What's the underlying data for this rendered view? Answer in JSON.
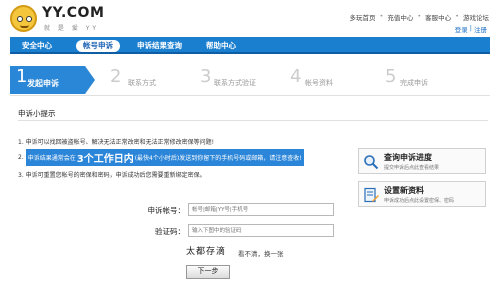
{
  "brand": {
    "name": "YY.COM",
    "slogan": "就 是 爱 YY"
  },
  "topnav": [
    "多玩首页",
    "充值中心",
    "客服中心",
    "游戏论坛"
  ],
  "userlinks": {
    "login": "登录",
    "sep": "|",
    "register": "注册"
  },
  "navbar": {
    "items": [
      "安全中心",
      "帐号申诉",
      "申诉结果查询",
      "帮助中心"
    ],
    "active_index": 1
  },
  "steps": [
    {
      "num": "1",
      "label": "发起申诉"
    },
    {
      "num": "2",
      "label": "联系方式"
    },
    {
      "num": "3",
      "label": "联系方式验证"
    },
    {
      "num": "4",
      "label": "帐号资料"
    },
    {
      "num": "5",
      "label": "完成申诉"
    }
  ],
  "tips": {
    "title": "申诉小提示",
    "line1": "1. 申诉可以找回被盗帐号、解决无法正常改密和无法正常修改密保等问题!",
    "line2_prefix": "2.",
    "line2_a": "申诉结果通常会在",
    "line2_big": "3个工作日内",
    "line2_b": "(最快4个小时后)发送到你留下的手机号码或邮箱，请注意查收!",
    "line3": "3. 申诉可重置您帐号的密保和密码，申诉成功后您需要重新绑定密保。"
  },
  "sideboxes": [
    {
      "title": "查询申诉进度",
      "desc": "提交申诉后点此查看结果"
    },
    {
      "title": "设置新资料",
      "desc": "申诉成功后点此设置密保、密码"
    }
  ],
  "form": {
    "account_label": "申诉帐号：",
    "account_placeholder": "帐号|邮箱|YY号|手机号",
    "code_label": "验证码：",
    "code_placeholder": "输入下图中的验证码",
    "captcha_text": "太都存滴",
    "captcha_refresh": "看不清，换一张",
    "submit": "下一步"
  }
}
